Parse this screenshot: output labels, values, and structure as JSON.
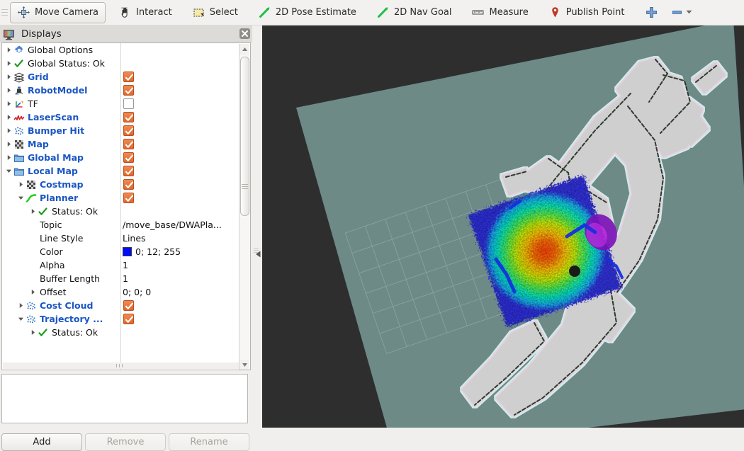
{
  "toolbar": {
    "tools": [
      {
        "label": "Move Camera",
        "icon": "move-camera-icon",
        "active": true
      },
      {
        "label": "Interact",
        "icon": "interact-hand-icon",
        "active": false
      },
      {
        "label": "Select",
        "icon": "select-marquee-icon",
        "active": false
      },
      {
        "label": "2D Pose Estimate",
        "icon": "pose-estimate-arrow-icon",
        "active": false
      },
      {
        "label": "2D Nav Goal",
        "icon": "nav-goal-arrow-icon",
        "active": false
      },
      {
        "label": "Measure",
        "icon": "measure-ruler-icon",
        "active": false
      },
      {
        "label": "Publish Point",
        "icon": "publish-point-pin-icon",
        "active": false
      }
    ],
    "add_tool_icon": "plus-icon",
    "remove_tool_icon": "minus-icon",
    "remove_tool_dropdown_icon": "chevron-down-icon"
  },
  "panel": {
    "title": "Displays",
    "close_icon": "close-icon",
    "buttons": {
      "add": "Add",
      "remove": "Remove",
      "rename": "Rename"
    },
    "buttons_enabled": {
      "add": true,
      "remove": false,
      "rename": false
    }
  },
  "colors": {
    "display_name": "#1a56c4",
    "checkbox_on": "#e0662c",
    "status_ok": "#1f9b1f",
    "viewport_background": "#2e2e2e",
    "map_plane": "#6d8a87",
    "planner_line": "#000cff",
    "robot_dot": "#1a1a1a"
  },
  "tree": {
    "rows": [
      {
        "indent": 0,
        "arrow": "right",
        "icon": "gear-icon",
        "label": "Global Options",
        "style": "plain",
        "check": null,
        "value": null
      },
      {
        "indent": 0,
        "arrow": "right",
        "icon": "check-icon",
        "label": "Global Status: Ok",
        "style": "plain",
        "check": null,
        "value": null
      },
      {
        "indent": 0,
        "arrow": "right",
        "icon": "grid-icon",
        "label": "Grid",
        "style": "display",
        "check": true,
        "value": null
      },
      {
        "indent": 0,
        "arrow": "right",
        "icon": "robot-icon",
        "label": "RobotModel",
        "style": "display",
        "check": true,
        "value": null
      },
      {
        "indent": 0,
        "arrow": "right",
        "icon": "tf-axes-icon",
        "label": "TF",
        "style": "plain",
        "check": false,
        "value": null
      },
      {
        "indent": 0,
        "arrow": "right",
        "icon": "laserscan-icon",
        "label": "LaserScan",
        "style": "display",
        "check": true,
        "value": null
      },
      {
        "indent": 0,
        "arrow": "right",
        "icon": "pointcloud-icon",
        "label": "Bumper Hit",
        "style": "display",
        "check": true,
        "value": null
      },
      {
        "indent": 0,
        "arrow": "right",
        "icon": "map-icon",
        "label": "Map",
        "style": "display",
        "check": true,
        "value": null
      },
      {
        "indent": 0,
        "arrow": "right",
        "icon": "folder-icon",
        "label": "Global Map",
        "style": "display",
        "check": true,
        "value": null
      },
      {
        "indent": 0,
        "arrow": "down",
        "icon": "folder-icon",
        "label": "Local Map",
        "style": "display",
        "check": true,
        "value": null
      },
      {
        "indent": 1,
        "arrow": "right",
        "icon": "map-icon",
        "label": "Costmap",
        "style": "display",
        "check": true,
        "value": null
      },
      {
        "indent": 1,
        "arrow": "down",
        "icon": "path-icon",
        "label": "Planner",
        "style": "display",
        "check": true,
        "value": null
      },
      {
        "indent": 2,
        "arrow": "right",
        "icon": "check-icon",
        "label": "Status: Ok",
        "style": "plain",
        "check": null,
        "value": null
      },
      {
        "indent": 2,
        "arrow": "none",
        "icon": "none",
        "label": "Topic",
        "style": "prop",
        "check": null,
        "value": "/move_base/DWAPla..."
      },
      {
        "indent": 2,
        "arrow": "none",
        "icon": "none",
        "label": "Line Style",
        "style": "prop",
        "check": null,
        "value": "Lines"
      },
      {
        "indent": 2,
        "arrow": "none",
        "icon": "none",
        "label": "Color",
        "style": "prop",
        "check": null,
        "value": "0; 12; 255",
        "swatch": "#000cff"
      },
      {
        "indent": 2,
        "arrow": "none",
        "icon": "none",
        "label": "Alpha",
        "style": "prop",
        "check": null,
        "value": "1"
      },
      {
        "indent": 2,
        "arrow": "none",
        "icon": "none",
        "label": "Buffer Length",
        "style": "prop",
        "check": null,
        "value": "1"
      },
      {
        "indent": 2,
        "arrow": "right",
        "icon": "none",
        "label": "Offset",
        "style": "prop",
        "check": null,
        "value": "0; 0; 0"
      },
      {
        "indent": 1,
        "arrow": "right",
        "icon": "pointcloud-icon",
        "label": "Cost Cloud",
        "style": "display",
        "check": true,
        "value": null
      },
      {
        "indent": 1,
        "arrow": "down",
        "icon": "pointcloud-icon",
        "label": "Trajectory ...",
        "style": "display",
        "check": true,
        "value": null
      },
      {
        "indent": 2,
        "arrow": "right",
        "icon": "check-icon",
        "label": "Status: Ok",
        "style": "plain",
        "check": null,
        "value": null
      }
    ]
  },
  "viewport": {
    "description": "3D render view: rotated occupancy grid map plane with global costmap corridors, local costmap rainbow cost cloud and robot position",
    "scene_items": [
      "map-plane",
      "grid",
      "global-costmap",
      "local-costmap",
      "cost-cloud",
      "robot-marker"
    ]
  }
}
